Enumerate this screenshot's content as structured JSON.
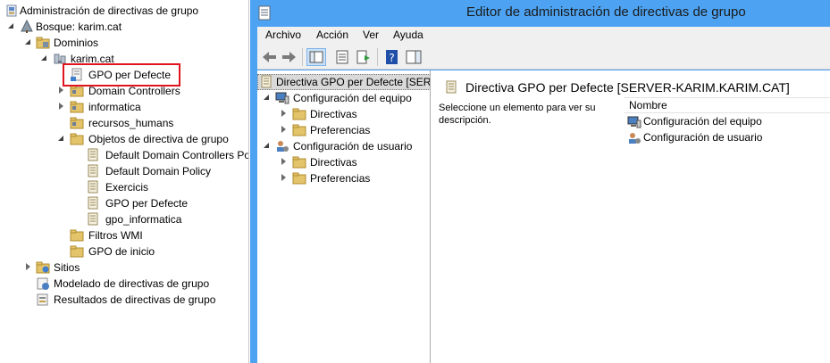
{
  "gpmc": {
    "items": [
      {
        "label": "Administración de directivas de grupo"
      },
      {
        "label": "Bosque: karim.cat"
      },
      {
        "label": "Dominios"
      },
      {
        "label": "karim.cat"
      },
      {
        "label": "GPO per Defecte"
      },
      {
        "label": "Domain Controllers"
      },
      {
        "label": "informatica"
      },
      {
        "label": "recursos_humans"
      },
      {
        "label": "Objetos de directiva de grupo"
      },
      {
        "label": "Default Domain Controllers Po"
      },
      {
        "label": "Default Domain Policy"
      },
      {
        "label": "Exercicis"
      },
      {
        "label": "GPO per Defecte"
      },
      {
        "label": "gpo_informatica"
      },
      {
        "label": "Filtros WMI"
      },
      {
        "label": "GPO de inicio"
      },
      {
        "label": "Sitios"
      },
      {
        "label": "Modelado de directivas de grupo"
      },
      {
        "label": "Resultados de directivas de grupo"
      }
    ]
  },
  "editor": {
    "title": "Editor de administración de directivas de grupo",
    "menu": [
      "Archivo",
      "Acción",
      "Ver",
      "Ayuda"
    ],
    "tree": {
      "root": "Directiva GPO per Defecte [SERV",
      "items": [
        {
          "label": "Configuración del equipo"
        },
        {
          "label": "Directivas"
        },
        {
          "label": "Preferencias"
        },
        {
          "label": "Configuración de usuario"
        },
        {
          "label": "Directivas"
        },
        {
          "label": "Preferencias"
        }
      ]
    },
    "details": {
      "title": "Directiva GPO per Defecte [SERVER-KARIM.KARIM.CAT]",
      "description": "Seleccione un elemento para ver su descripción.",
      "column_name": "Nombre",
      "rows": [
        "Configuración del equipo",
        "Configuración de usuario"
      ]
    }
  },
  "colors": {
    "title_bar": "#4da3f2",
    "highlight_border": "#e0141e",
    "selection": "#d9d9d9"
  }
}
